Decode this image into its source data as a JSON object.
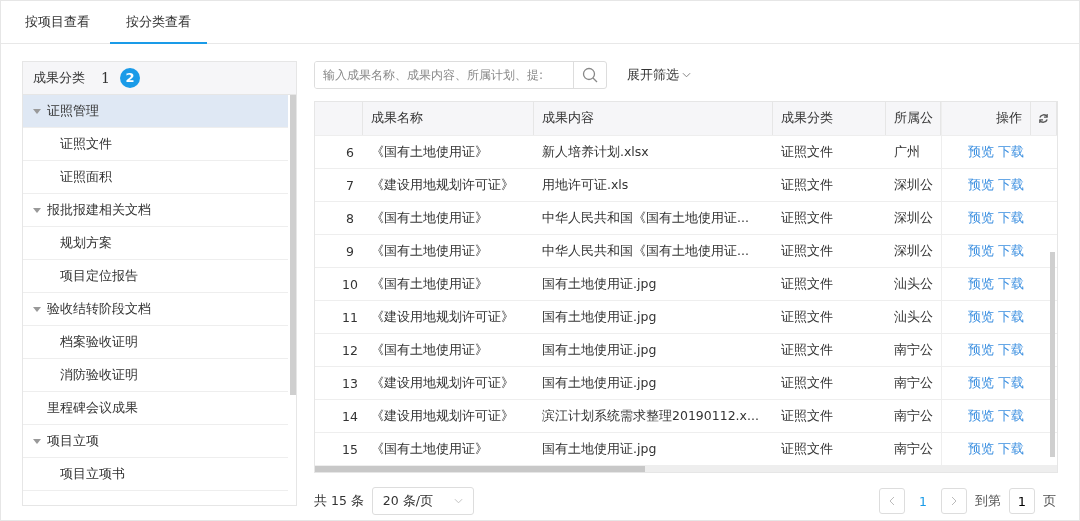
{
  "tabs": [
    {
      "label": "按项目查看",
      "selected": false
    },
    {
      "label": "按分类查看",
      "selected": true
    }
  ],
  "tree_panel": {
    "title": "成果分类",
    "marker_1": "1",
    "marker_2": "2",
    "items": [
      {
        "label": "证照管理",
        "expanded": true,
        "selected": true,
        "children": [
          {
            "label": "证照文件",
            "selected": false
          },
          {
            "label": "证照面积",
            "selected": false
          }
        ]
      },
      {
        "label": "报批报建相关文档",
        "expanded": true,
        "selected": false,
        "children": [
          {
            "label": "规划方案",
            "selected": false
          },
          {
            "label": "项目定位报告",
            "selected": false
          }
        ]
      },
      {
        "label": "验收结转阶段文档",
        "expanded": true,
        "selected": false,
        "children": [
          {
            "label": "档案验收证明",
            "selected": false
          },
          {
            "label": "消防验收证明",
            "selected": false
          }
        ]
      },
      {
        "label": "里程碑会议成果",
        "selected": false
      },
      {
        "label": "项目立项",
        "expanded": true,
        "selected": false,
        "children": [
          {
            "label": "项目立项书",
            "selected": false
          }
        ]
      }
    ]
  },
  "search": {
    "placeholder": "输入成果名称、成果内容、所属计划、提:"
  },
  "filter_toggle": "展开筛选",
  "table": {
    "columns": [
      "成果名称",
      "成果内容",
      "成果分类",
      "所属公",
      "操作"
    ],
    "rows": [
      {
        "index": "6",
        "name": "《国有土地使用证》",
        "content": "新人培养计划.xlsx",
        "category": "证照文件",
        "company": "广州",
        "actions": [
          "预览",
          "下载"
        ]
      },
      {
        "index": "7",
        "name": "《建设用地规划许可证》",
        "content": "用地许可证.xls",
        "category": "证照文件",
        "company": "深圳公",
        "actions": [
          "预览",
          "下载"
        ]
      },
      {
        "index": "8",
        "name": "《国有土地使用证》",
        "content": "中华人民共和国《国有土地使用证...",
        "category": "证照文件",
        "company": "深圳公",
        "actions": [
          "预览",
          "下载"
        ]
      },
      {
        "index": "9",
        "name": "《国有土地使用证》",
        "content": "中华人民共和国《国有土地使用证...",
        "category": "证照文件",
        "company": "深圳公",
        "actions": [
          "预览",
          "下载"
        ]
      },
      {
        "index": "10",
        "name": "《国有土地使用证》",
        "content": "国有土地使用证.jpg",
        "category": "证照文件",
        "company": "汕头公",
        "actions": [
          "预览",
          "下载"
        ]
      },
      {
        "index": "11",
        "name": "《建设用地规划许可证》",
        "content": "国有土地使用证.jpg",
        "category": "证照文件",
        "company": "汕头公",
        "actions": [
          "预览",
          "下载"
        ]
      },
      {
        "index": "12",
        "name": "《国有土地使用证》",
        "content": "国有土地使用证.jpg",
        "category": "证照文件",
        "company": "南宁公",
        "actions": [
          "预览",
          "下载"
        ]
      },
      {
        "index": "13",
        "name": "《建设用地规划许可证》",
        "content": "国有土地使用证.jpg",
        "category": "证照文件",
        "company": "南宁公",
        "actions": [
          "预览",
          "下载"
        ]
      },
      {
        "index": "14",
        "name": "《建设用地规划许可证》",
        "content": "滨江计划系统需求整理20190112.x...",
        "category": "证照文件",
        "company": "南宁公",
        "actions": [
          "预览",
          "下载"
        ]
      },
      {
        "index": "15",
        "name": "《国有土地使用证》",
        "content": "国有土地使用证.jpg",
        "category": "证照文件",
        "company": "南宁公",
        "actions": [
          "预览",
          "下载"
        ]
      }
    ]
  },
  "pagination": {
    "total": "共 15 条",
    "page_size": "20 条/页",
    "pages": [
      {
        "label": "1",
        "selected": true
      }
    ],
    "goto_label": "到第",
    "goto_value": "1",
    "goto_suffix": "页"
  }
}
